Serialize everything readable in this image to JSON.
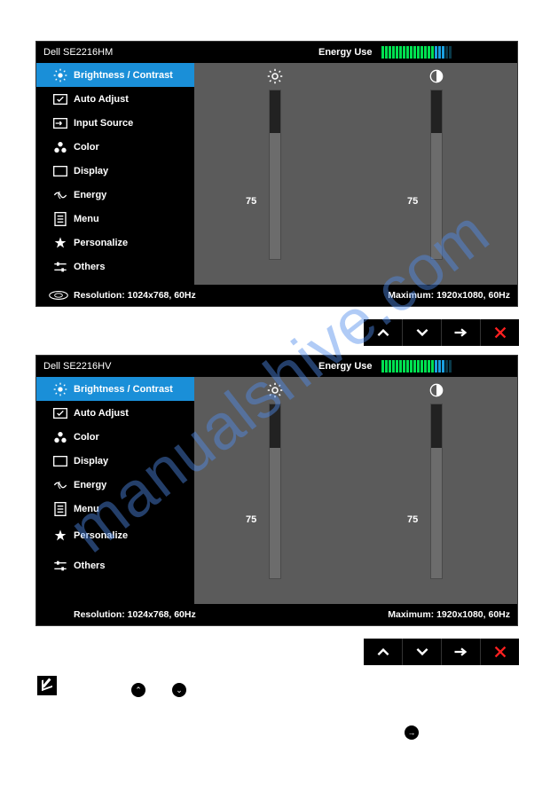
{
  "watermark": "manualshive.com",
  "osd1": {
    "title": "Dell  SE2216HM",
    "energy_label": "Energy Use",
    "sidebar": [
      {
        "label": "Brightness / Contrast",
        "active": true,
        "icon": "brightness-icon"
      },
      {
        "label": "Auto Adjust",
        "active": false,
        "icon": "auto-adjust-icon"
      },
      {
        "label": "Input Source",
        "active": false,
        "icon": "input-source-icon"
      },
      {
        "label": "Color",
        "active": false,
        "icon": "color-icon"
      },
      {
        "label": "Display",
        "active": false,
        "icon": "display-icon"
      },
      {
        "label": "Energy",
        "active": false,
        "icon": "energy-icon"
      },
      {
        "label": "Menu",
        "active": false,
        "icon": "menu-icon"
      },
      {
        "label": "Personalize",
        "active": false,
        "icon": "personalize-icon"
      },
      {
        "label": "Others",
        "active": false,
        "icon": "others-icon"
      }
    ],
    "brightness_value": "75",
    "contrast_value": "75",
    "footer_resolution": "Resolution: 1024x768,   60Hz",
    "footer_maximum": "Maximum: 1920x1080,   60Hz"
  },
  "osd2": {
    "title": "Dell SE2216HV",
    "energy_label": "Energy Use",
    "sidebar": [
      {
        "label": "Brightness / Contrast",
        "active": true,
        "icon": "brightness-icon"
      },
      {
        "label": "Auto Adjust",
        "active": false,
        "icon": "auto-adjust-icon"
      },
      {
        "label": "Color",
        "active": false,
        "icon": "color-icon"
      },
      {
        "label": "Display",
        "active": false,
        "icon": "display-icon"
      },
      {
        "label": "Energy",
        "active": false,
        "icon": "energy-icon"
      },
      {
        "label": "Menu",
        "active": false,
        "icon": "menu-icon"
      },
      {
        "label": "Personalize",
        "active": false,
        "icon": "personalize-icon"
      },
      {
        "label": "Others",
        "active": false,
        "icon": "others-icon"
      }
    ],
    "brightness_value": "75",
    "contrast_value": "75",
    "footer_resolution": "Resolution: 1024x768, 60Hz",
    "footer_maximum": "Maximum: 1920x1080, 60Hz"
  }
}
